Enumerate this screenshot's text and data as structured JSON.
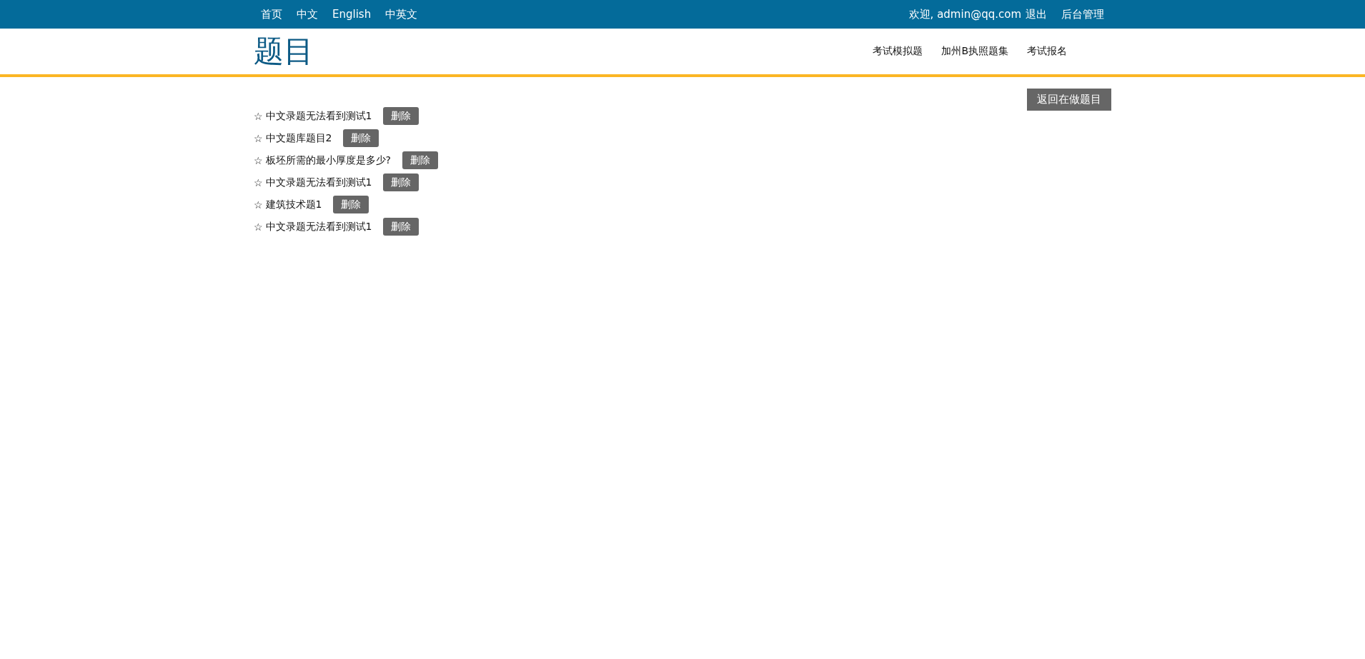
{
  "top_bar": {
    "links": [
      "首页",
      "中文",
      "English",
      "中英文"
    ],
    "welcome": "欢迎, admin@qq.com",
    "logout": "退出",
    "admin": "后台管理"
  },
  "header": {
    "title": "题目",
    "nav": [
      "考试模拟题",
      "加州B执照题集",
      "考试报名"
    ]
  },
  "back_button": "返回在做题目",
  "questions": [
    {
      "marker": "☆",
      "text": "中文录题无法看到测试1",
      "delete": "删除"
    },
    {
      "marker": "☆",
      "text": "中文题库题目2",
      "delete": "删除"
    },
    {
      "marker": "☆",
      "text": "板坯所需的最小厚度是多少?",
      "delete": "删除"
    },
    {
      "marker": "☆",
      "text": "中文录题无法看到测试1",
      "delete": "删除"
    },
    {
      "marker": "☆",
      "text": "建筑技术题1",
      "delete": "删除"
    },
    {
      "marker": "☆",
      "text": "中文录题无法看到测试1",
      "delete": "删除"
    }
  ]
}
